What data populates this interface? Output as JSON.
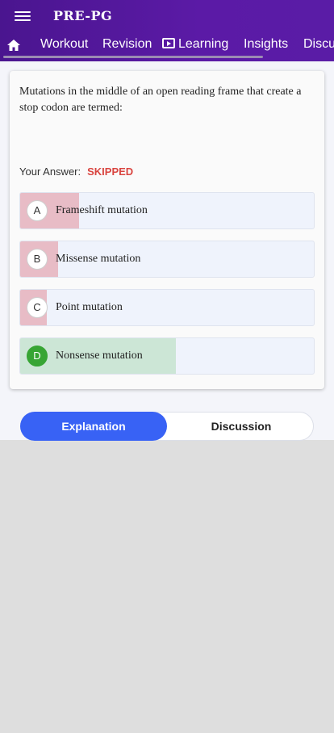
{
  "appbar": {
    "brand": "PRE-PG",
    "tabs": [
      {
        "label": "Workout"
      },
      {
        "label": "Revision"
      },
      {
        "label": "Learning"
      },
      {
        "label": "Insights"
      },
      {
        "label": "Discu"
      }
    ],
    "color": "#5219a0"
  },
  "question": {
    "text": "Mutations in the middle of an open reading frame that create a stop codon are termed:",
    "your_answer_label": "Your Answer:",
    "your_answer_value": "SKIPPED"
  },
  "options": [
    {
      "letter": "A",
      "text": "Frameshift mutation",
      "percent": 20,
      "correct": false
    },
    {
      "letter": "B",
      "text": "Missense mutation",
      "percent": 13,
      "correct": false
    },
    {
      "letter": "C",
      "text": "Point mutation",
      "percent": 9,
      "correct": false
    },
    {
      "letter": "D",
      "text": "Nonsense mutation",
      "percent": 53,
      "correct": true
    }
  ],
  "toggle": {
    "explanation": "Explanation",
    "discussion": "Discussion",
    "active": "Explanation",
    "accent": "#3862f5"
  }
}
